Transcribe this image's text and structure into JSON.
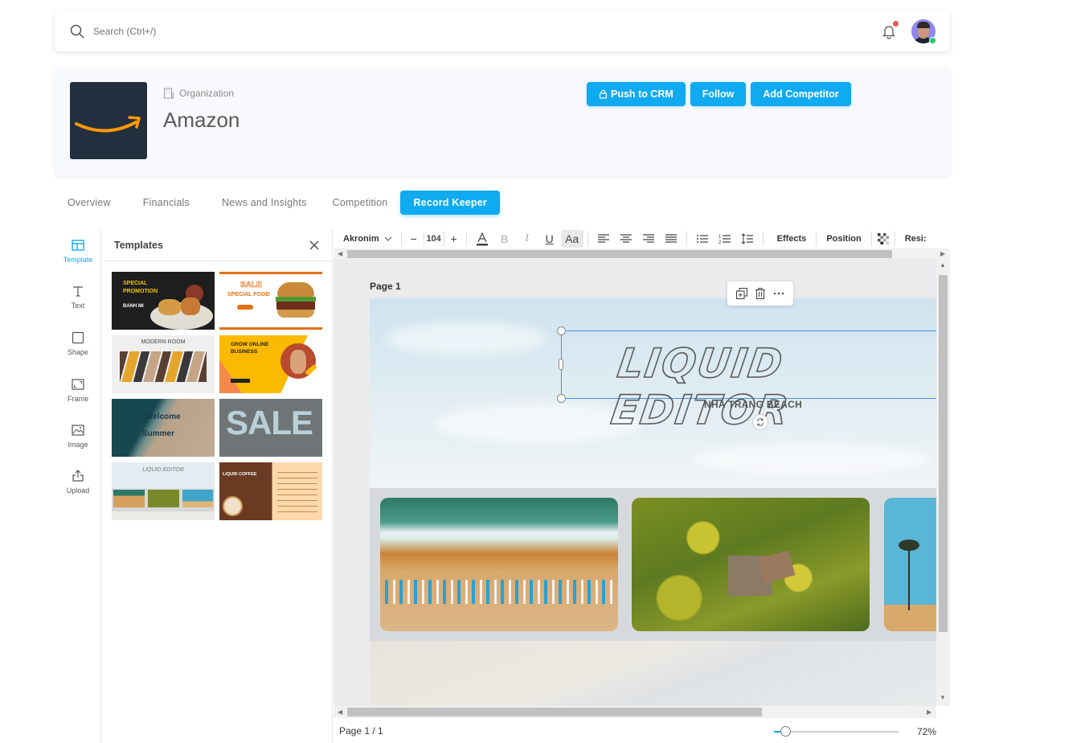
{
  "topbar": {
    "search_placeholder": "Search (Ctrl+/)",
    "notification_has_badge": true,
    "user_status": "online"
  },
  "organization": {
    "type_label": "Organization",
    "name": "Amazon",
    "logo": "amazon-smile-logo",
    "colors": {
      "logo_bg": "#232f3e",
      "logo_arrow": "#ff9900"
    }
  },
  "actions": {
    "push_to_crm": "Push to CRM",
    "follow": "Follow",
    "add_competitor": "Add Competitor",
    "accent": "#10aaf0"
  },
  "tabs": [
    {
      "label": "Overview",
      "active": false
    },
    {
      "label": "Financials",
      "active": false
    },
    {
      "label": "News and Insights",
      "active": false
    },
    {
      "label": "Competition",
      "active": false
    },
    {
      "label": "Record Keeper",
      "active": true
    }
  ],
  "left_rail": [
    {
      "label": "Template",
      "icon": "template-icon",
      "active": true
    },
    {
      "label": "Text",
      "icon": "text-icon",
      "active": false
    },
    {
      "label": "Shape",
      "icon": "shape-icon",
      "active": false
    },
    {
      "label": "Frame",
      "icon": "frame-icon",
      "active": false
    },
    {
      "label": "Image",
      "icon": "image-icon",
      "active": false
    },
    {
      "label": "Upload",
      "icon": "upload-icon",
      "active": false
    }
  ],
  "templates_panel": {
    "title": "Templates",
    "items": [
      {
        "name": "Special Promotion - Banh Mi",
        "line1": "SPECIAL",
        "line2": "PROMOTION",
        "line3": "BANH MI"
      },
      {
        "name": "Sale Special Food",
        "line1": "SALE",
        "line2": "SPECIAL FOOD"
      },
      {
        "name": "Modern Room",
        "line1": "MODERN ROOM"
      },
      {
        "name": "Grow Online Business",
        "line1": "GROW ONLINE",
        "line2": "BUSINESS"
      },
      {
        "name": "Welcome Summer",
        "line1": "Welcome",
        "line2": "Summer"
      },
      {
        "name": "Sale Photo Letters",
        "line1": "SALE"
      },
      {
        "name": "Liquid Editor",
        "line1": "LIQUID EDITOR"
      },
      {
        "name": "Liquid Coffee",
        "line1": "LIQUID COFFEE"
      }
    ]
  },
  "toolbar": {
    "font_family": "Akronim",
    "font_size": "104",
    "minus": "−",
    "plus": "+",
    "bold": "B",
    "italic": "I",
    "underline": "U",
    "case": "Aa",
    "effects": "Effects",
    "position": "Position",
    "resize": "Resi:"
  },
  "canvas": {
    "page_label": "Page 1",
    "title": "LIQUID EDITOR",
    "subtitle": "NHA TRANG BEACH",
    "photos": [
      "beach-boats-aerial",
      "palm-trees-aerial",
      "palm-trees-sky"
    ]
  },
  "footer": {
    "page_indicator": "Page 1 / 1",
    "zoom_percent": 72,
    "zoom_label": "72%"
  }
}
